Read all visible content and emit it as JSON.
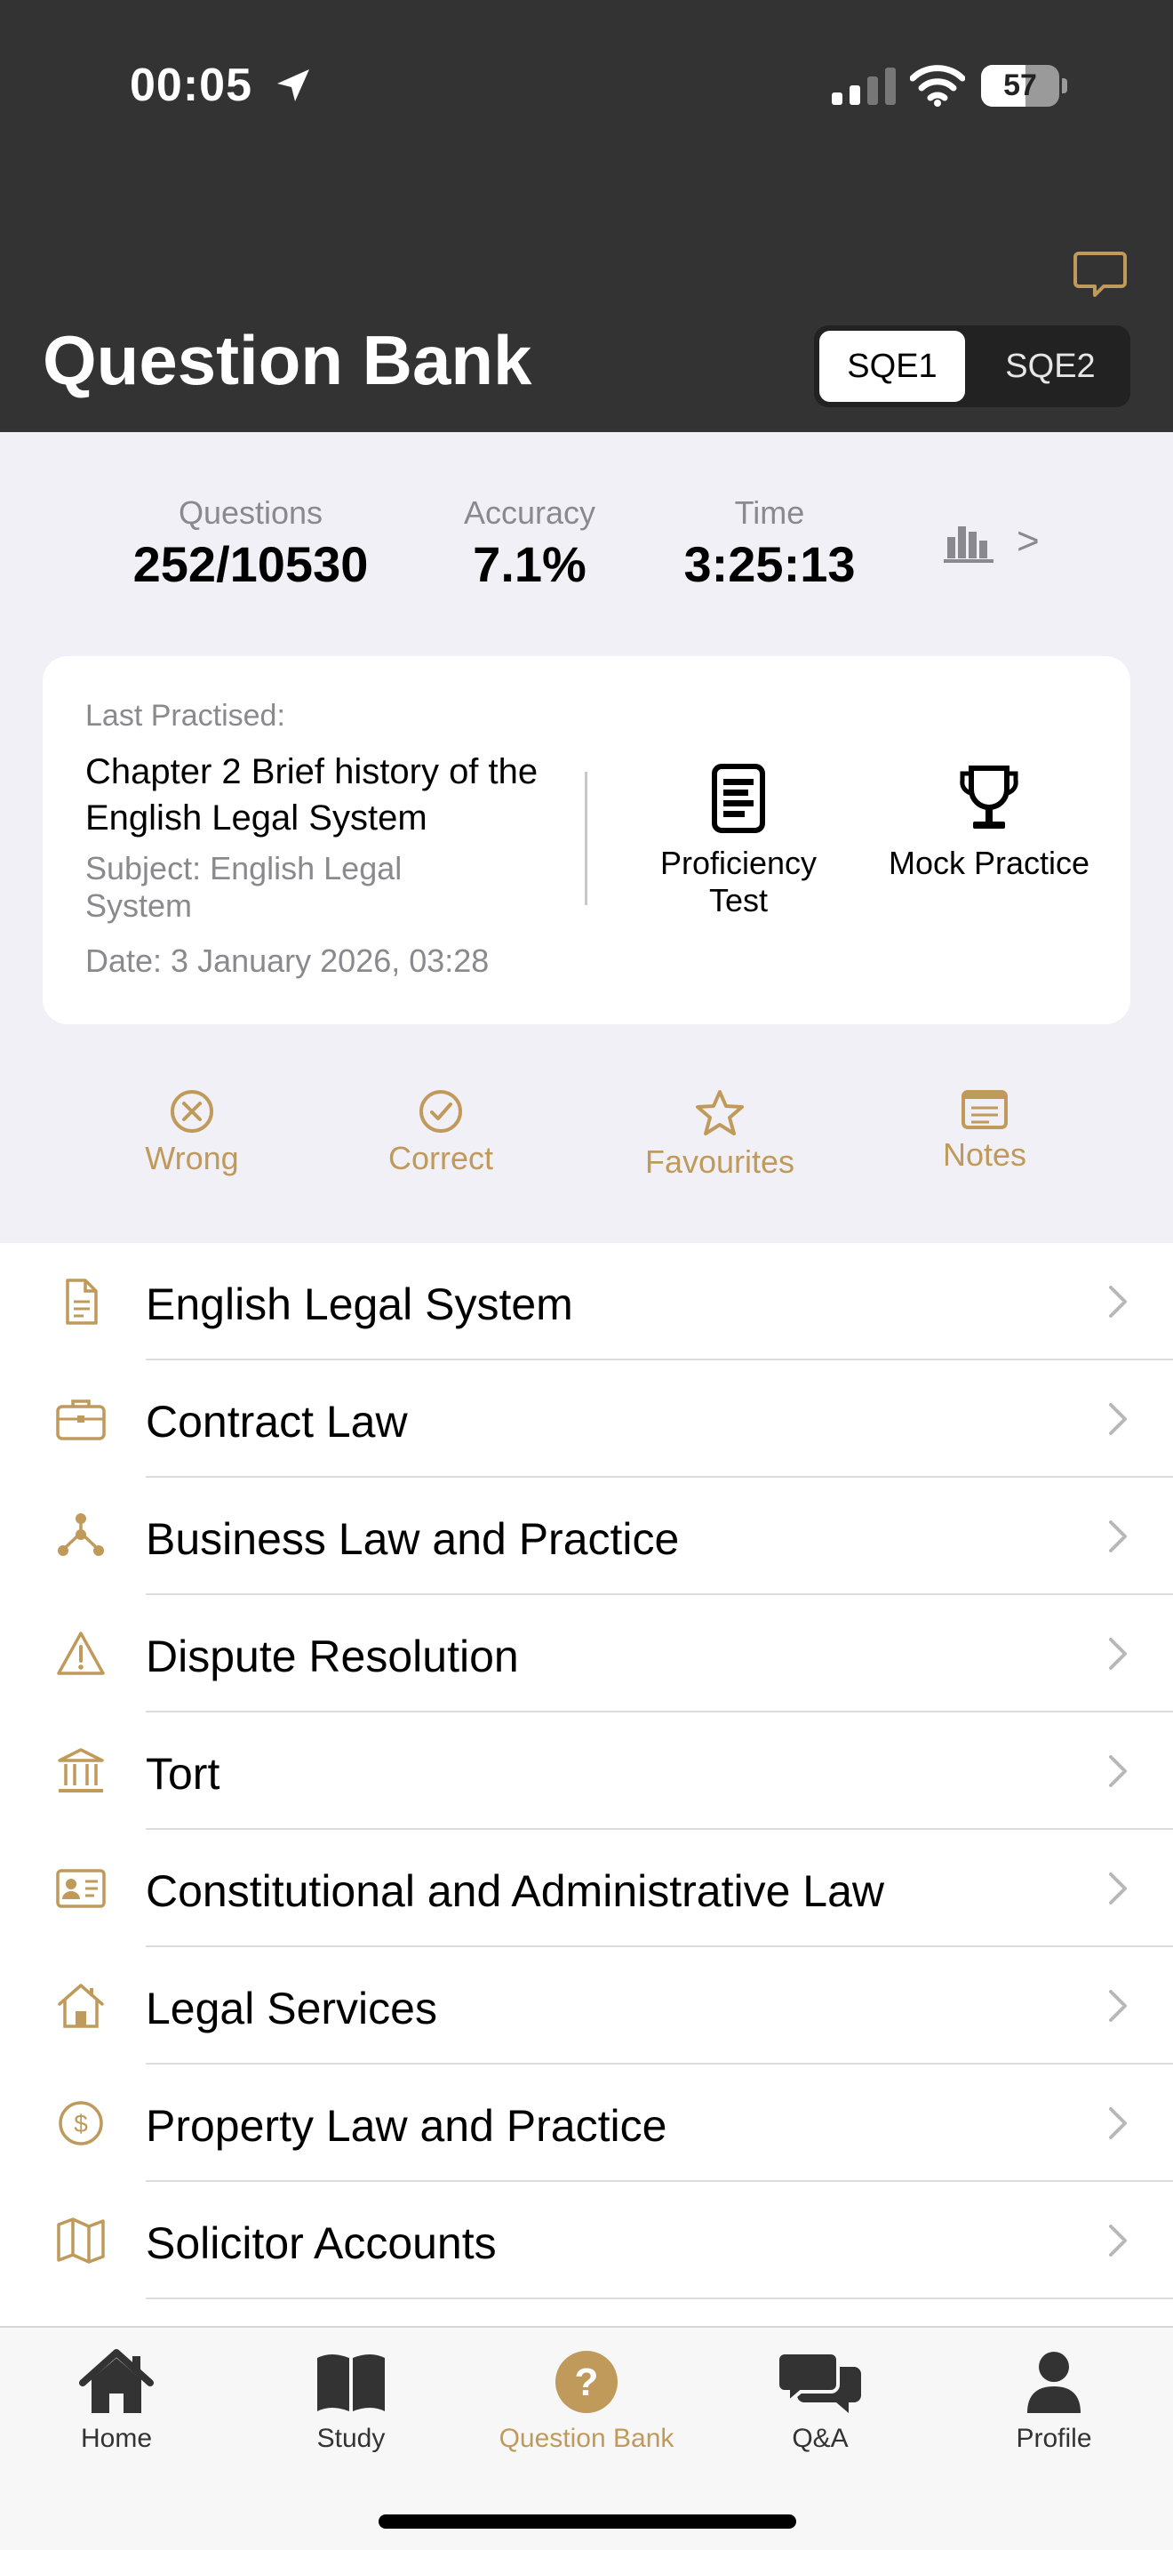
{
  "status_bar": {
    "time": "00:05",
    "battery_level": "57",
    "battery_fraction": 0.57
  },
  "header": {
    "title": "Question Bank",
    "segments": [
      "SQE1",
      "SQE2"
    ],
    "selected_segment": "SQE1"
  },
  "stats": {
    "questions_label": "Questions",
    "questions_value": "252/10530",
    "accuracy_label": "Accuracy",
    "accuracy_value": "7.1%",
    "time_label": "Time",
    "time_value": "3:25:13",
    "more_label": ">"
  },
  "last_practised": {
    "label": "Last Practised:",
    "title": "Chapter 2 Brief history of the English Legal System",
    "subject": "Subject: English Legal System",
    "date": "Date: 3 January 2026, 03:28"
  },
  "card_actions": [
    {
      "label": "Proficiency Test",
      "icon": "document-icon"
    },
    {
      "label": "Mock Practice",
      "icon": "trophy-icon"
    }
  ],
  "quick_filters": [
    {
      "label": "Wrong",
      "icon": "x-circle-icon"
    },
    {
      "label": "Correct",
      "icon": "check-circle-icon"
    },
    {
      "label": "Favourites",
      "icon": "star-icon"
    },
    {
      "label": "Notes",
      "icon": "notes-icon"
    }
  ],
  "subjects": [
    {
      "label": "English Legal System",
      "icon": "document-icon"
    },
    {
      "label": "Contract Law",
      "icon": "briefcase-icon"
    },
    {
      "label": "Business Law and Practice",
      "icon": "network-icon"
    },
    {
      "label": "Dispute Resolution",
      "icon": "warning-icon"
    },
    {
      "label": "Tort",
      "icon": "bank-icon"
    },
    {
      "label": "Constitutional and Administrative Law",
      "icon": "id-card-icon"
    },
    {
      "label": "Legal Services",
      "icon": "house-icon"
    },
    {
      "label": "Property Law and Practice",
      "icon": "dollar-circle-icon"
    },
    {
      "label": "Solicitor Accounts",
      "icon": "map-icon"
    }
  ],
  "tabs": [
    {
      "label": "Home",
      "icon": "home-icon"
    },
    {
      "label": "Study",
      "icon": "book-icon"
    },
    {
      "label": "Question Bank",
      "icon": "question-icon",
      "active": true
    },
    {
      "label": "Q&A",
      "icon": "chat-bubbles-icon"
    },
    {
      "label": "Profile",
      "icon": "person-icon"
    }
  ],
  "colors": {
    "accent": "#c09a5b",
    "header_bg": "#333333",
    "page_bg": "#f0f0f6"
  }
}
